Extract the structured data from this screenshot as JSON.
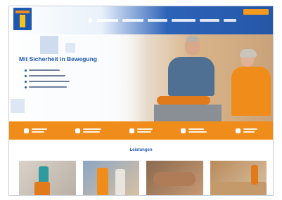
{
  "hero": {
    "title": "Mit Sicherheit in Bewegung"
  },
  "services": {
    "title": "Leistungen"
  },
  "colors": {
    "brand_blue": "#1d58b0",
    "accent_orange": "#f08d1a",
    "logo_yellow": "#f7c21a"
  },
  "icons": [
    "home-icon",
    "check-icon",
    "phone-icon",
    "calendar-icon",
    "camera-icon",
    "location-icon"
  ]
}
